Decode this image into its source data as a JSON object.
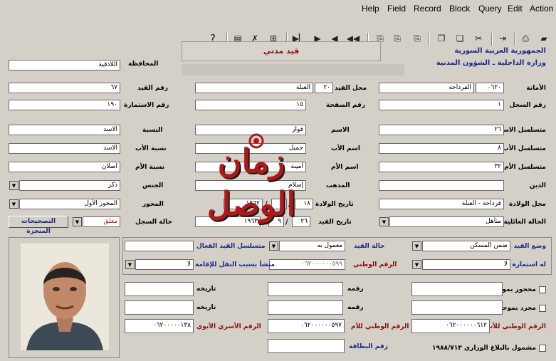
{
  "menu": [
    "Help",
    "Field",
    "Record",
    "Block",
    "Query",
    "Edit",
    "Action"
  ],
  "header": {
    "title": "قيد مدني",
    "republic": "الجمهورية العربية السورية",
    "ministry": "وزارة الداخلية ـ الشؤون المدنية",
    "governorate_label": "المحافظة",
    "governorate_value": "اللاذقية"
  },
  "fields": {
    "amana_label": "الأمانة",
    "amana_code": "٠٦٢٠",
    "amana_value": "القرداحة",
    "mahal_qaid_label": "محل القيد",
    "mahal_qaid_num": "٢٠",
    "mahal_qaid_value": "العبلة",
    "raqm_qaid_label": "رقم القيد",
    "raqm_qaid_value": "٦٧",
    "raqm_sijil_label": "رقم السجل",
    "raqm_sijil_value": "١",
    "raqm_safha_label": "رقم الصفحة",
    "raqm_safha_value": "١٥",
    "raqm_istimara_label": "رقم الاستمارة",
    "raqm_istimara_value": "١٩٠",
    "mutasalsil_ism_label": "متسلسل الاسم",
    "mutasalsil_ism_value": "٢٦",
    "ism_label": "الاسم",
    "ism_value": "فواز",
    "nisba_label": "النسبة",
    "nisba_value": "الاسد",
    "mutasalsil_ab_label": "متسلسل الأب",
    "mutasalsil_ab_value": "٨",
    "ism_ab_label": "اسم الأب",
    "ism_ab_value": "جميل",
    "nisbat_ab_label": "نسبة الأب",
    "nisbat_ab_value": "الاسد",
    "mutasalsil_um_label": "متسلسل الأم",
    "mutasalsil_um_value": "٣٢",
    "ism_um_label": "اسم الأم",
    "ism_um_value": "أمينة",
    "nisbat_um_label": "نسبة الأم",
    "nisbat_um_value": "اصلان",
    "din_label": "الدين",
    "din_value": "",
    "madhhab_label": "المذهب",
    "madhhab_value": "إسلام",
    "jins_label": "الجنس",
    "jins_value": "ذكر",
    "mahal_wilada_label": "محل الولادة",
    "mahal_wilada_value": "قرداحة - العبلة",
    "tarikh_wilada_label": "تاريخ الولادة",
    "wilada_day": "١٨",
    "wilada_month": "٦",
    "wilada_year": "١٩٦٢",
    "mihwar_label": "المحور",
    "mihwar_value": "المحور الأول",
    "hala_aailiya_label": "الحالة العائلية",
    "hala_aailiya_value": "متأهل",
    "tarikh_qaid_label": "تاريخ القيد",
    "qaid_day": "٢٦",
    "qaid_month": "٩",
    "qaid_year": "١٩٦٣",
    "halat_sijil_label": "حالة السجل",
    "halat_sijil_value": "مغلق",
    "corrections_button": "التصحيحات المنجزة",
    "wad_qaid_label": "وضع القيد",
    "wad_qaid_value": "ضمن المسكن",
    "halat_qaid_label": "حالة القيد",
    "halat_qaid_value": "معمول به",
    "mutasalsil_faal_label": "متسلسل القيد الفعال",
    "mutasalsil_faal_value": "",
    "istimara_sabiqa_label": "له استمارة سابقة",
    "istimara_sabiqa_value": "لا",
    "raqm_watani_label": "الرقم الوطني",
    "raqm_watani_value": "٠٦٢٠٠٠٠٠٠٥٩٩",
    "munsha_label": "منشأ بسبب النقل للإقامة",
    "munsha_value": "لا",
    "mahjur_label": "محجور بموجب",
    "mahjur_value": "",
    "raqmuhu_label": "رقمه",
    "raqmuhu_value": "",
    "tarikhuhu_label": "تاريخه",
    "tarikhuhu_value": "",
    "mujarrad_label": "مجرد بموجب",
    "mujarrad_value": "",
    "raqmuhu2_label": "رقمه",
    "raqmuhu2_value": "",
    "tarikhuhu2_label": "تاريخه",
    "tarikhuhu2_value": "",
    "watani_ab_label": "الرقم الوطني للأب",
    "watani_ab_value": "٠٦٢٠٠٠٠٠٠٦١٢",
    "watani_um_label": "الرقم الوطني للأم",
    "watani_um_value": "٠٦٢٠٠٠٠٠٠٥٩٧",
    "usari_abawi_label": "الرقم الأسري الأبوي",
    "usari_abawi_value": "٠٦٢٠٠٠٠٠١٣٨",
    "mashmul_label": "مشمول بالبلاغ الوزاري ١٩٨٨/٧١٣",
    "raqm_bitaqa_label": "رقم البطاقة",
    "raqm_bitaqa_value": ""
  },
  "watermark": {
    "text": "زمان الوصل"
  },
  "colors": {
    "background": "#d4d0c8",
    "label_blue": "#1c2a8a",
    "label_red": "#8a1010",
    "watermark_red": "#b01818"
  }
}
